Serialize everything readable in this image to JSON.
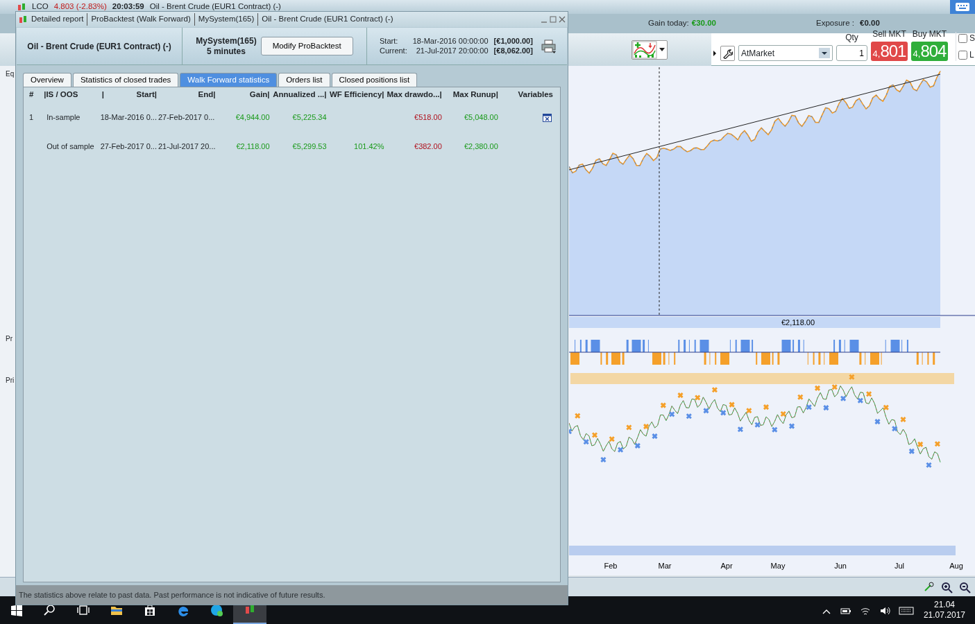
{
  "app": {
    "symbol": "LCO",
    "change": "4.803 (-2.83%)",
    "time": "20:03:59",
    "instrument": "Oil - Brent Crude (EUR1 Contract) (-)",
    "side_labels": [
      "Eq",
      "Pr",
      "Pri"
    ]
  },
  "account": {
    "gain_label": "Gain today:",
    "gain": "€30.00",
    "exposure_label": "Exposure :",
    "exposure": "€0.00"
  },
  "order_bar": {
    "order_type": "AtMarket",
    "qty_label": "Qty",
    "qty": "1",
    "sell_label": "Sell MKT",
    "sell_small": "4,",
    "sell_big": "801",
    "buy_label": "Buy MKT",
    "buy_small": "4,",
    "buy_big": "804",
    "options": [
      {
        "label": "S",
        "checked": false
      },
      {
        "label": "L",
        "checked": false
      }
    ]
  },
  "chart": {
    "equity_label": "€2,118.00",
    "months": [
      "Feb",
      "Mar",
      "Apr",
      "May",
      "Jun",
      "Jul",
      "Aug"
    ]
  },
  "dialog": {
    "title_parts": [
      "Detailed report",
      "ProBacktest (Walk Forward)",
      "MySystem(165)",
      "Oil - Brent Crude (EUR1 Contract) (-)"
    ],
    "instrument": "Oil - Brent Crude (EUR1 Contract) (-)",
    "system": "MySystem(165)",
    "timeframe": "5 minutes",
    "modify_button": "Modify ProBacktest",
    "start_label": "Start:",
    "start": "18-Mar-2016 00:00:00",
    "start_capital": "[€1,000.00]",
    "current_label": "Current:",
    "current": "21-Jul-2017 20:00:00",
    "current_capital": "[€8,062.00]",
    "tabs": [
      {
        "label": "Overview",
        "selected": false
      },
      {
        "label": "Statistics of closed trades",
        "selected": false
      },
      {
        "label": "Walk Forward statistics",
        "selected": true
      },
      {
        "label": "Orders list",
        "selected": false
      },
      {
        "label": "Closed positions list",
        "selected": false
      }
    ],
    "table": {
      "columns": [
        {
          "label": "#"
        },
        {
          "label": "|IS / OOS"
        },
        {
          "lead": "|",
          "label": "Start|"
        },
        {
          "label": "End|"
        },
        {
          "label": "Gain|"
        },
        {
          "label": "Annualized ...|"
        },
        {
          "label": "WF Efficiency|"
        },
        {
          "label": "Max drawdo...|"
        },
        {
          "label": "Max Runup|"
        },
        {
          "label": "Variables"
        }
      ],
      "rows": [
        {
          "cells": [
            "1",
            "In-sample",
            "18-Mar-2016 0...",
            "27-Feb-2017 0...",
            "€4,944.00",
            "€5,225.34",
            null,
            "€518.00",
            "€5,048.00"
          ],
          "has_variables": true
        },
        {
          "cells": [
            null,
            "Out of sample",
            "27-Feb-2017 0...",
            "21-Jul-2017 20...",
            "€2,118.00",
            "€5,299.53",
            "101.42%",
            "€382.00",
            "€2,380.00"
          ],
          "has_variables": false
        }
      ]
    },
    "footer": "The statistics above relate to past data. Past performance is not indicative of future results."
  },
  "taskbar": {
    "time": "21.04",
    "date": "21.07.2017"
  }
}
